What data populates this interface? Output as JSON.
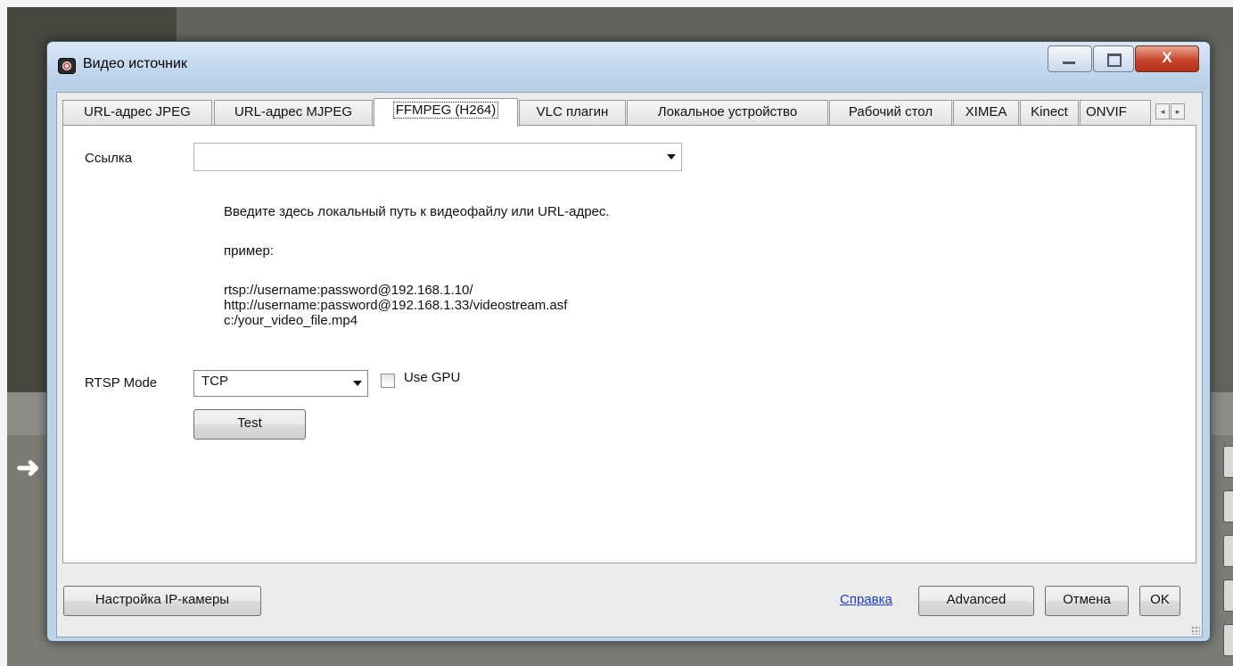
{
  "window": {
    "title": "Видео источник",
    "close_glyph": "X"
  },
  "tabs": [
    {
      "label": "URL-адрес JPEG"
    },
    {
      "label": "URL-адрес MJPEG"
    },
    {
      "label": "FFMPEG (H264)",
      "active": true
    },
    {
      "label": "VLC плагин"
    },
    {
      "label": "Локальное устройство"
    },
    {
      "label": "Рабочий стол"
    },
    {
      "label": "XIMEA"
    },
    {
      "label": "Kinect"
    },
    {
      "label": "ONVIF"
    }
  ],
  "tab_scroll": {
    "left": "◂",
    "right": "▸"
  },
  "ffmpeg": {
    "link_label": "Ссылка",
    "link_value": "",
    "help_line1": "Введите здесь локальный путь к видеофайлу или URL-адрес.",
    "help_example_label": "пример:",
    "examples": [
      "rtsp://username:password@192.168.1.10/",
      "http://username:password@192.168.1.33/videostream.asf",
      "c:/your_video_file.mp4"
    ],
    "rtsp_mode_label": "RTSP Mode",
    "rtsp_mode_value": "TCP",
    "use_gpu_label": "Use GPU",
    "use_gpu_checked": false,
    "test_label": "Test"
  },
  "footer": {
    "ip_camera_setup": "Настройка IP-камеры",
    "help_link": "Справка",
    "advanced": "Advanced",
    "cancel": "Отмена",
    "ok": "OK"
  },
  "background": {
    "arrow_glyph": "➜"
  },
  "colors": {
    "link": "#1a3ecb",
    "close_button": "#c7452a",
    "title_bar": "#c6daf0"
  }
}
